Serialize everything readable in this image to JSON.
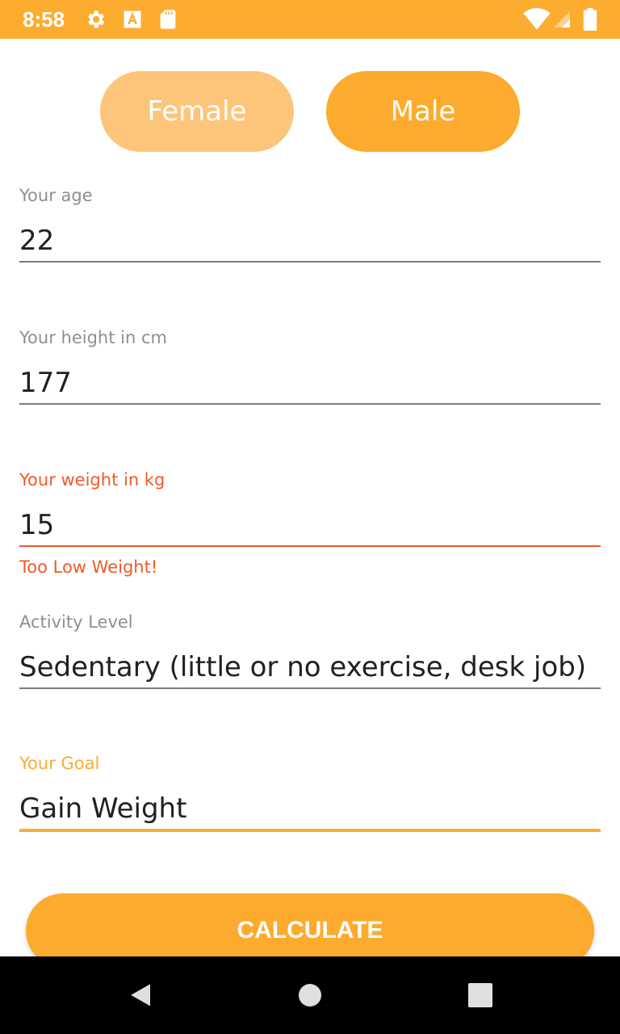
{
  "status_bar": {
    "time": "8:58",
    "icons": [
      "gear-icon",
      "a-icon",
      "sd-card-icon",
      "wifi-icon",
      "signal-icon",
      "battery-icon"
    ],
    "color": "#fcad2f"
  },
  "gender": {
    "female_label": "Female",
    "male_label": "Male",
    "selected": "Male"
  },
  "fields": {
    "age": {
      "label": "Your age",
      "value": "22"
    },
    "height": {
      "label": "Your height in cm",
      "value": "177"
    },
    "weight": {
      "label": "Your weight in kg",
      "value": "15",
      "error": "Too Low Weight!"
    },
    "activity": {
      "label": "Activity Level",
      "value": "Sedentary (little or no exercise, desk job)"
    },
    "goal": {
      "label": "Your Goal",
      "value": "Gain Weight"
    }
  },
  "calculate_label": "CALCULATE",
  "colors": {
    "accent": "#fcab2e",
    "accent_light": "#fdc57a",
    "error": "#f0592b"
  },
  "nav_bar": {
    "icons": [
      "back-icon",
      "home-icon",
      "recents-icon"
    ]
  }
}
